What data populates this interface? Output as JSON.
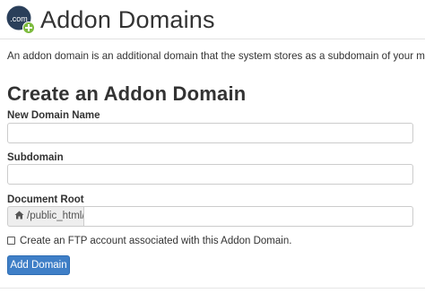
{
  "header": {
    "title": "Addon Domains",
    "icon": "addon-domain-icon",
    "icon_text": ".com"
  },
  "intro": {
    "text": "An addon domain is an additional domain that the system stores as a subdomain of your main site. Use addon"
  },
  "form": {
    "section_title": "Create an Addon Domain",
    "new_domain": {
      "label": "New Domain Name",
      "value": "",
      "placeholder": ""
    },
    "subdomain": {
      "label": "Subdomain",
      "value": "",
      "placeholder": ""
    },
    "document_root": {
      "label": "Document Root",
      "prefix": "/public_html/",
      "prefix_icon": "home-icon",
      "value": ""
    },
    "ftp_checkbox": {
      "label": "Create an FTP account associated with this Addon Domain.",
      "checked": false
    },
    "submit_label": "Add Domain"
  },
  "colors": {
    "button": "#3f7fc7",
    "icon_dark": "#2a3f5a",
    "icon_plus": "#7dbb3e"
  }
}
